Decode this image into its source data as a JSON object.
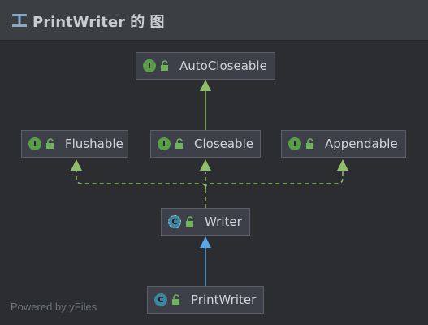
{
  "header": {
    "title": "PrintWriter 的 图",
    "title_icon": "hierarchy-icon"
  },
  "nodes": [
    {
      "id": "autocloseable",
      "kind": "interface",
      "badge": "I",
      "label": "AutoCloseable"
    },
    {
      "id": "flushable",
      "kind": "interface",
      "badge": "I",
      "label": "Flushable"
    },
    {
      "id": "closeable",
      "kind": "interface",
      "badge": "I",
      "label": "Closeable"
    },
    {
      "id": "appendable",
      "kind": "interface",
      "badge": "I",
      "label": "Appendable"
    },
    {
      "id": "writer",
      "kind": "abstract-class",
      "badge": "C",
      "label": "Writer"
    },
    {
      "id": "printwriter",
      "kind": "class",
      "badge": "C",
      "label": "PrintWriter"
    }
  ],
  "edges": [
    {
      "from": "closeable",
      "to": "autocloseable",
      "relation": "extends"
    },
    {
      "from": "writer",
      "to": "flushable",
      "relation": "implements"
    },
    {
      "from": "writer",
      "to": "closeable",
      "relation": "implements"
    },
    {
      "from": "writer",
      "to": "appendable",
      "relation": "implements"
    },
    {
      "from": "printwriter",
      "to": "writer",
      "relation": "extends"
    }
  ],
  "watermark": "Powered by yFiles",
  "colors": {
    "background": "#2b2d30",
    "header": "#3c3f41",
    "node_fill": "#3d4048",
    "interface_edge": "#8fbf6a",
    "class_edge": "#5aa6e6",
    "interface_badge": "#5a9e4a",
    "class_badge": "#3e86a0",
    "lock": "#6fb35c"
  }
}
